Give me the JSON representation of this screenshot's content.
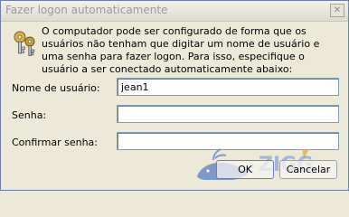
{
  "window": {
    "title": "Fazer logon automaticamente",
    "close_glyph": "✕"
  },
  "description": "O computador pode ser configurado de forma que os usuários não tenham que digitar um nome de usuário e uma senha para fazer logon. Para isso, especifique o usuário a ser conectado automaticamente abaixo:",
  "form": {
    "username_label": "Nome de usuário:",
    "username_value": "jean1",
    "password_label": "Senha:",
    "password_value": "",
    "confirm_label": "Confirmar senha:",
    "confirm_value": ""
  },
  "buttons": {
    "ok": "OK",
    "cancel": "Cancelar"
  },
  "watermark": {
    "text": "ZIGG",
    "icon": "whale-logo"
  },
  "colors": {
    "accent_blue": "#2e67c8",
    "watermark_blue": "#6b8fd6"
  }
}
